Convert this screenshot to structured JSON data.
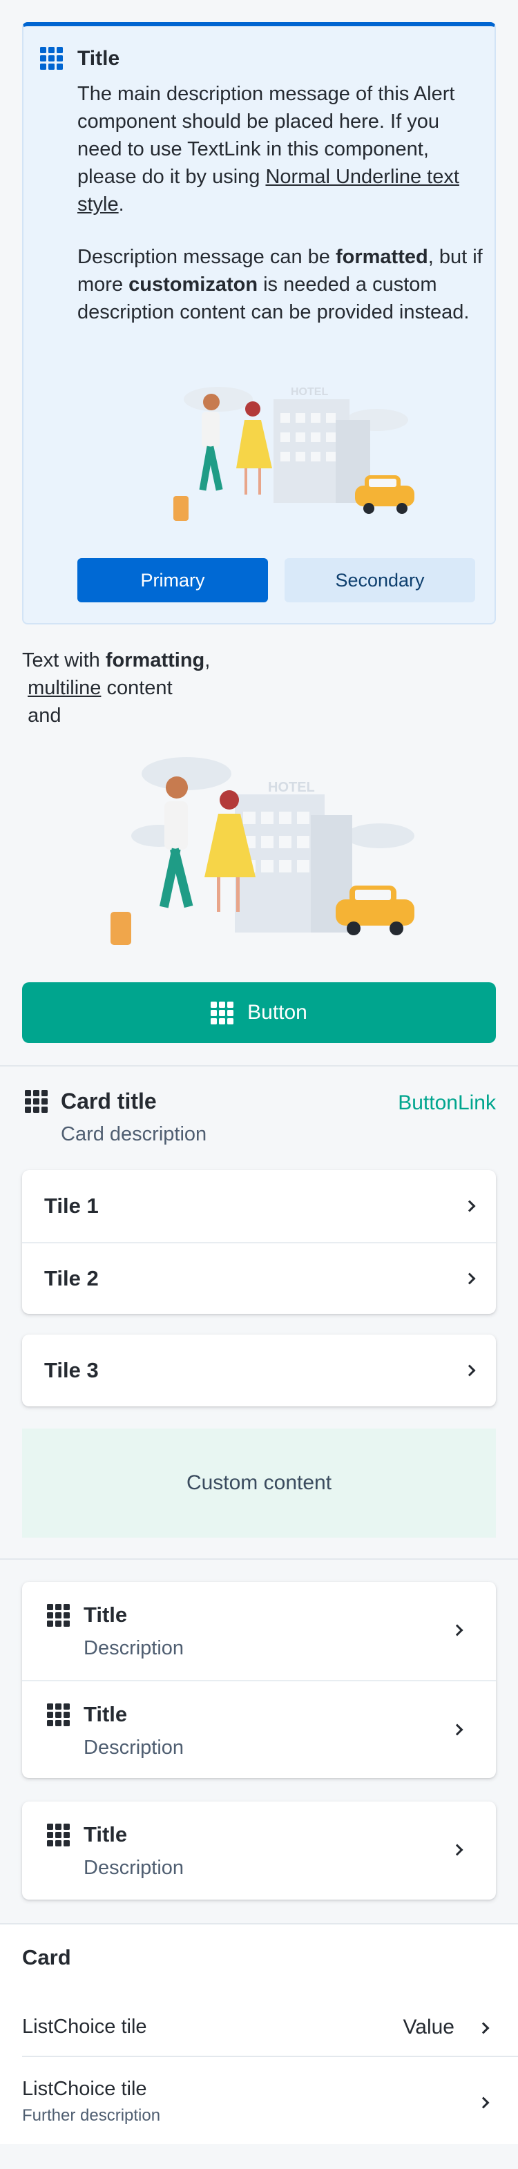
{
  "alert": {
    "title": "Title",
    "desc_line1": "The main description message of this Alert component should be placed here. If you need to use TextLink in this component, please do it by using ",
    "desc_link": "Normal Underline text style",
    "desc_end": ".",
    "desc2_a": "Description message can be ",
    "desc2_b": "formatted",
    "desc2_c": ", but if more ",
    "desc2_d": "customizaton",
    "desc2_e": " is needed a custom description content can be provided instead.",
    "primary_label": "Primary",
    "secondary_label": "Secondary",
    "accent": "#0065d1"
  },
  "formatted": {
    "part1": "Text with ",
    "bold": "formatting",
    "part2": ",",
    "underline": "multiline",
    "part3": " content",
    "part4": "and"
  },
  "illustration_text": "HOTEL",
  "big_button": {
    "label": "Button",
    "color": "#00a58e"
  },
  "card": {
    "title": "Card title",
    "description": "Card description",
    "link": "ButtonLink",
    "tiles_group": [
      "Tile 1",
      "Tile 2"
    ],
    "tile_single": "Tile 3",
    "custom_content": "Custom content"
  },
  "icon_tiles_group": [
    {
      "title": "Title",
      "description": "Description"
    },
    {
      "title": "Title",
      "description": "Description"
    }
  ],
  "icon_tile_single": {
    "title": "Title",
    "description": "Description"
  },
  "card2": {
    "title": "Card",
    "choice1": {
      "label": "ListChoice tile",
      "value": "Value"
    },
    "choice2": {
      "label": "ListChoice tile",
      "description": "Further description"
    }
  }
}
